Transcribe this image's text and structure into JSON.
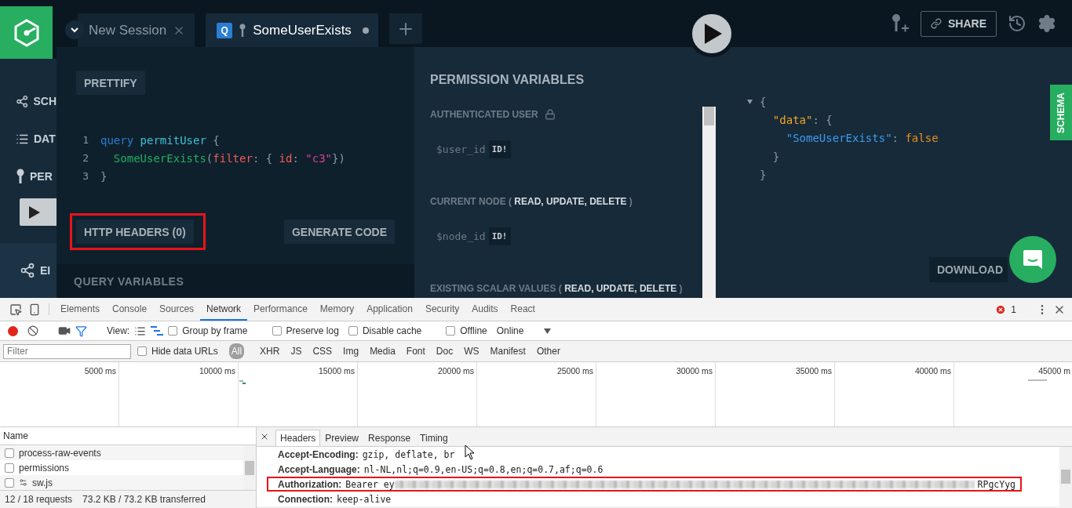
{
  "playground": {
    "sidebar": {
      "items": [
        {
          "kind": "schema",
          "label": "SCH"
        },
        {
          "kind": "data",
          "label": "DAT"
        },
        {
          "kind": "permissions",
          "label": "PER"
        },
        {
          "kind": "endpoints",
          "label": "EI"
        }
      ]
    },
    "tabs": [
      {
        "title": "New Session",
        "selected": false,
        "unsaved": false,
        "closable": true
      },
      {
        "badge": "Q",
        "title": "SomeUserExists",
        "selected": true,
        "unsaved": true,
        "closable": false
      }
    ],
    "share_label": "SHARE",
    "editor": {
      "prettify": "PRETTIFY",
      "lines": [
        {
          "number": "1",
          "tokens": [
            {
              "kind": "keyword",
              "text": "query "
            },
            {
              "kind": "def",
              "text": "permitUser"
            },
            {
              "kind": "punct",
              "text": " {"
            }
          ]
        },
        {
          "number": "2",
          "tokens": [
            {
              "kind": "field",
              "text": "  SomeUserExists"
            },
            {
              "kind": "punct",
              "text": "("
            },
            {
              "kind": "arg",
              "text": "filter"
            },
            {
              "kind": "punct",
              "text": ": { "
            },
            {
              "kind": "arg",
              "text": "id"
            },
            {
              "kind": "punct",
              "text": ": "
            },
            {
              "kind": "string",
              "text": "\"c3\""
            },
            {
              "kind": "punct",
              "text": "})"
            }
          ]
        },
        {
          "number": "3",
          "tokens": [
            {
              "kind": "punct",
              "text": "}"
            }
          ]
        }
      ],
      "http_headers": {
        "label": "HTTP HEADERS (0)",
        "highlighted": true
      },
      "generate_code": "GENERATE CODE",
      "query_variables": "QUERY VARIABLES"
    },
    "permissions": {
      "title": "PERMISSION VARIABLES",
      "sections": [
        {
          "heading": "AUTHENTICATED USER",
          "locked": true,
          "variable": "$user_id",
          "type": "ID!"
        },
        {
          "heading": "CURRENT NODE ( **READ, UPDATE, DELETE** )",
          "locked": false,
          "variable": "$node_id",
          "type": "ID!"
        },
        {
          "heading": "EXISTING SCALAR VALUES ( **READ, UPDATE, DELETE** )",
          "locked": false
        }
      ]
    },
    "result": {
      "expanded": true,
      "lines": [
        {
          "tokens": [
            {
              "kind": "punct",
              "text": "{"
            }
          ]
        },
        {
          "tokens": [
            {
              "kind": "key",
              "text": "  \"data\""
            },
            {
              "kind": "punct",
              "text": ": {"
            }
          ]
        },
        {
          "tokens": [
            {
              "kind": "field",
              "text": "    \"SomeUserExists\""
            },
            {
              "kind": "punct",
              "text": ": "
            },
            {
              "kind": "bool",
              "text": "false"
            }
          ]
        },
        {
          "tokens": [
            {
              "kind": "punct",
              "text": "  }"
            }
          ]
        },
        {
          "tokens": [
            {
              "kind": "punct",
              "text": "}"
            }
          ]
        }
      ],
      "schema_tab": "SCHEMA",
      "download": "DOWNLOAD"
    }
  },
  "devtools": {
    "tabs": [
      {
        "label": "Elements",
        "selected": false
      },
      {
        "label": "Console",
        "selected": false
      },
      {
        "label": "Sources",
        "selected": false
      },
      {
        "label": "Network",
        "selected": true
      },
      {
        "label": "Performance",
        "selected": false
      },
      {
        "label": "Memory",
        "selected": false
      },
      {
        "label": "Application",
        "selected": false
      },
      {
        "label": "Security",
        "selected": false
      },
      {
        "label": "Audits",
        "selected": false
      },
      {
        "label": "React",
        "selected": false
      }
    ],
    "error_count": "1",
    "toolbar": {
      "recording": true,
      "view_label": "View:",
      "checkboxes": [
        {
          "label": "Group by frame",
          "checked": false
        },
        {
          "label": "Preserve log",
          "checked": false
        },
        {
          "label": "Disable cache",
          "checked": false
        },
        {
          "label": "Offline",
          "checked": false
        }
      ],
      "throttling": "Online"
    },
    "filter": {
      "placeholder": "Filter",
      "hide_data_urls": {
        "label": "Hide data URLs",
        "checked": false
      },
      "types": [
        {
          "label": "All",
          "selected": true
        },
        {
          "label": "XHR",
          "selected": false
        },
        {
          "label": "JS",
          "selected": false
        },
        {
          "label": "CSS",
          "selected": false
        },
        {
          "label": "Img",
          "selected": false
        },
        {
          "label": "Media",
          "selected": false
        },
        {
          "label": "Font",
          "selected": false
        },
        {
          "label": "Doc",
          "selected": false
        },
        {
          "label": "WS",
          "selected": false
        },
        {
          "label": "Manifest",
          "selected": false
        },
        {
          "label": "Other",
          "selected": false
        }
      ]
    },
    "timeline": {
      "ticks": [
        "5000 ms",
        "10000 ms",
        "15000 ms",
        "20000 ms",
        "25000 ms",
        "30000 ms",
        "35000 ms",
        "40000 ms",
        "45000 m"
      ]
    },
    "requests": {
      "header": "Name",
      "rows": [
        {
          "name": "process-raw-events",
          "kind": "plain"
        },
        {
          "name": "permissions",
          "kind": "plain"
        },
        {
          "name": "sw.js",
          "kind": "worker"
        }
      ],
      "status": "12 / 18 requests",
      "size": "73.2 KB / 73.2 KB transferred"
    },
    "details": {
      "tabs": [
        {
          "label": "Headers",
          "selected": true
        },
        {
          "label": "Preview",
          "selected": false
        },
        {
          "label": "Response",
          "selected": false
        },
        {
          "label": "Timing",
          "selected": false
        }
      ],
      "headers": [
        {
          "name": "Accept-Encoding:",
          "value": "gzip, deflate, br",
          "redacted": false,
          "highlighted": false
        },
        {
          "name": "Accept-Language:",
          "value": "nl-NL,nl;q=0.9,en-US;q=0.8,en;q=0.7,af;q=0.6",
          "redacted": false,
          "highlighted": false
        },
        {
          "name": "Authorization:",
          "value": "Bearer ey",
          "redacted": true,
          "tail": "RPgcYyg",
          "highlighted": true
        },
        {
          "name": "Connection:",
          "value": "keep-alive",
          "redacted": false,
          "highlighted": false
        }
      ]
    }
  }
}
